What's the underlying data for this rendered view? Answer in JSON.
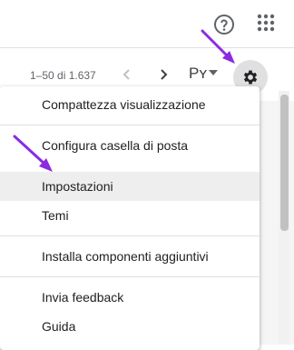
{
  "header": {
    "help_icon": "help-circle-icon",
    "apps_icon": "apps-grid-icon"
  },
  "toolbar": {
    "pagination_text": "1–50 di 1.637",
    "prev_icon": "chevron-left-icon",
    "next_icon": "chevron-right-icon",
    "input_tools_label": "Pʏ",
    "input_tools_dropdown_icon": "caret-down-icon",
    "settings_icon": "gear-icon"
  },
  "settings_menu": {
    "items": [
      {
        "label": "Compattezza visualizzazione"
      },
      {
        "label": "Configura casella di posta"
      },
      {
        "label": "Impostazioni"
      },
      {
        "label": "Temi"
      },
      {
        "label": "Installa componenti aggiuntivi"
      },
      {
        "label": "Invia feedback"
      },
      {
        "label": "Guida"
      }
    ]
  },
  "colors": {
    "annotation_arrow": "#8a2be2",
    "menu_hover": "#eeeeee",
    "gear_bg": "#e0e0e0"
  }
}
